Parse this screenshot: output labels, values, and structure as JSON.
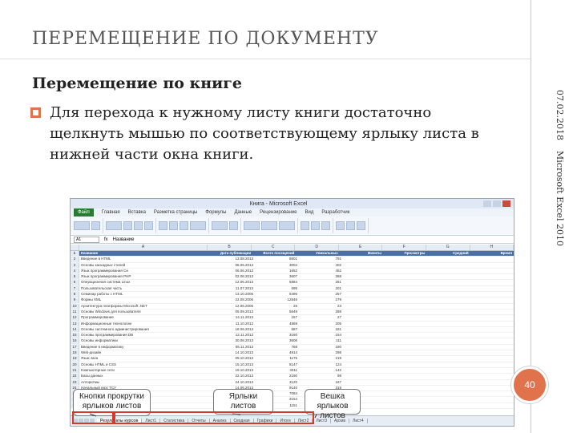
{
  "slide": {
    "title": "ПЕРЕМЕЩЕНИЕ ПО ДОКУМЕНТУ",
    "heading": "Перемещение по книге",
    "bullet": "Для перехода к нужному листу книги достаточно щелкнуть мышью по соответствующему ярлыку листа в нижней части окна книги.",
    "date": "07.02.2018",
    "subject": "Microsoft Excel 2010",
    "page_number": "40"
  },
  "excel": {
    "window_title": "Книга - Microsoft Excel",
    "menu": [
      "Файл",
      "Главная",
      "Вставка",
      "Разметка страницы",
      "Формулы",
      "Данные",
      "Рецензирование",
      "Вид",
      "Разработчик"
    ],
    "name_box": "A1",
    "formula": "Название",
    "columns": [
      "A",
      "B",
      "C",
      "D",
      "E",
      "F",
      "G",
      "H"
    ],
    "header_row": [
      "Название",
      "Дата публикации",
      "Всего посещений",
      "Уникальных",
      "Визиты",
      "Просмотры",
      "Средний",
      "Время"
    ],
    "rows": [
      [
        "Введение в HTML",
        "13.08.2013",
        "8601",
        "791"
      ],
      [
        "Основы каскадных стилей",
        "06.06.2013",
        "3004",
        "402"
      ],
      [
        "Язык программирования Си",
        "06.06.2013",
        "1652",
        "452"
      ],
      [
        "Язык программирования PHP",
        "02.08.2013",
        "3607",
        "368"
      ],
      [
        "Операционная система Linux",
        "12.06.2013",
        "5884",
        "251"
      ],
      [
        "Пользовательская часть",
        "11.07.2013",
        "695",
        "201"
      ],
      [
        "Семинар работы с HTML",
        "13.10.2006",
        "6496",
        "257"
      ],
      [
        "Формы XML",
        "22.08.2006",
        "12846",
        "279"
      ],
      [
        "Архитектура платформы Microsoft .NET",
        "12.06.2006",
        "26",
        "23"
      ],
      [
        "Основы Windows для пользователя",
        "05.09.2013",
        "5649",
        "288"
      ],
      [
        "Программирование",
        "14.11.2013",
        "157",
        "27"
      ],
      [
        "Информационные технологии",
        "11.10.2012",
        "4869",
        "205"
      ],
      [
        "Основы системного администрирования",
        "18.06.2013",
        "587",
        "181"
      ],
      [
        "Основы программирования DB",
        "12.11.2013",
        "3180",
        "154"
      ],
      [
        "Основы информатики",
        "30.08.2013",
        "3606",
        "111"
      ],
      [
        "Введение в информатику",
        "05.11.2013",
        "768",
        "180"
      ],
      [
        "Web-дизайн",
        "14.10.2013",
        "4914",
        "298"
      ],
      [
        "Язык Java",
        "09.10.2013",
        "1175",
        "219"
      ],
      [
        "Основы HTML и CSS",
        "15.10.2013",
        "8147",
        "124"
      ],
      [
        "Компьютерные сети",
        "19.10.2013",
        "4011",
        "142"
      ],
      [
        "Базы данных",
        "22.10.2013",
        "2190",
        "98"
      ],
      [
        "Алгоритмы",
        "24.10.2013",
        "3120",
        "167"
      ],
      [
        "Начальный курс ТСУ",
        "14.06.2013",
        "9140",
        "319"
      ],
      [
        "Операционные системы Windows XP",
        "14.06.2013",
        "7084",
        "281"
      ],
      [
        "Сетевые технологии",
        "17.06.2013",
        "3154",
        "261"
      ],
      [
        "Работа в современном офисе",
        "17.06.2013",
        "1151",
        "335"
      ]
    ],
    "sheet_tabs": [
      "Результаты курсов",
      "Лист1",
      "Статистика",
      "Отчеты",
      "Анализ",
      "Сводная",
      "Графики",
      "Итоги",
      "Лист2",
      "Лист3",
      "Архив",
      "Лист4"
    ]
  },
  "callouts": {
    "scroll_buttons": "Кнопки прокрутки ярлыков листов",
    "sheet_tabs": "Ярлыки листов",
    "tab_splitter": "Вешка ярлыков листов"
  },
  "colors": {
    "badge": "#e0734b",
    "highlight": "#d23b2c",
    "header": "#4a6fa5"
  }
}
